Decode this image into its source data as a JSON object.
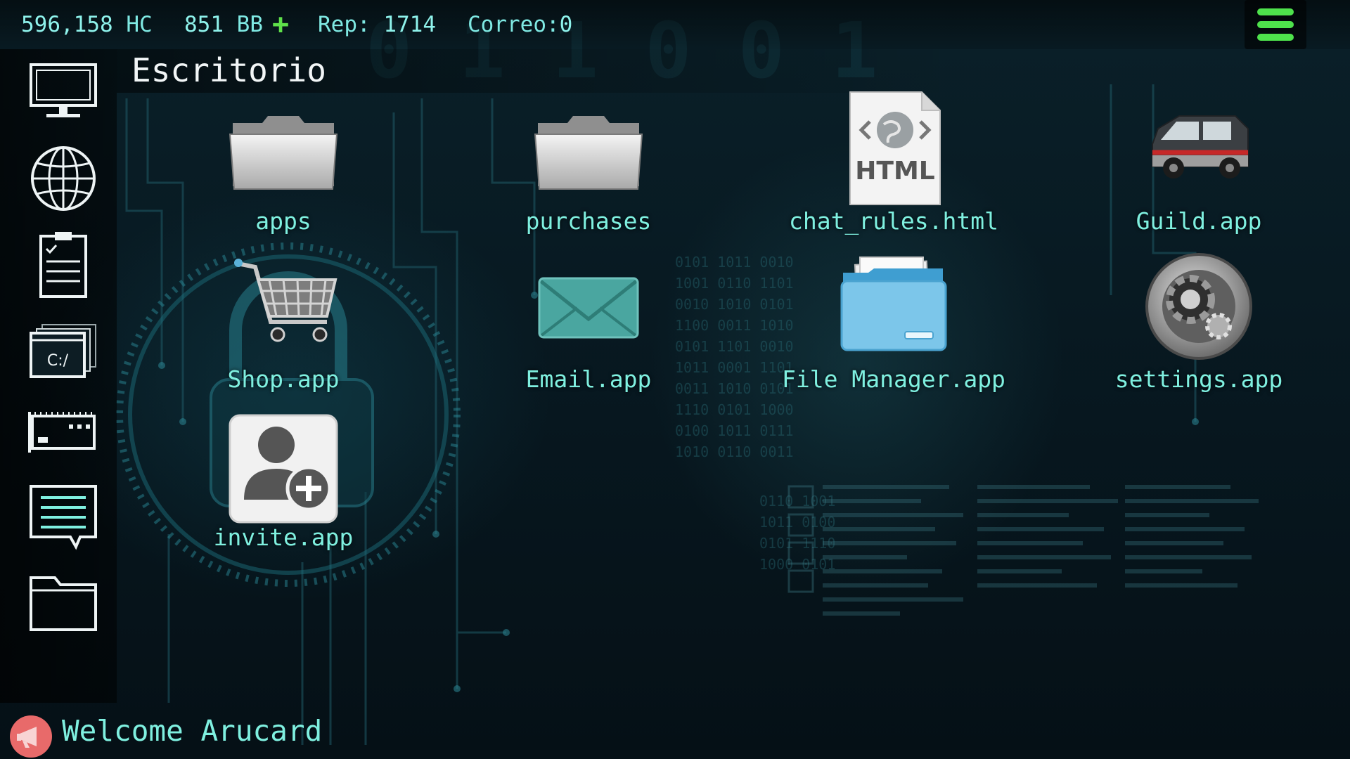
{
  "status": {
    "hc_value": "596,158",
    "hc_unit": "HC",
    "bb_value": "851",
    "bb_unit": "BB",
    "bb_add": "+",
    "rep_label": "Rep:",
    "rep_value": "1714",
    "mail_label": "Correo:",
    "mail_value": "0"
  },
  "menu": {
    "icon": "hamburger-menu-icon",
    "color": "#4ee24c"
  },
  "sidebar": {
    "items": [
      {
        "name": "desktop",
        "icon": "monitor-icon"
      },
      {
        "name": "browser",
        "icon": "globe-icon"
      },
      {
        "name": "tasks",
        "icon": "clipboard-checklist-icon"
      },
      {
        "name": "terminal",
        "icon": "terminal-window-icon",
        "text": "C:/"
      },
      {
        "name": "hardware",
        "icon": "hardware-board-icon"
      },
      {
        "name": "chat",
        "icon": "chat-bubble-icon"
      },
      {
        "name": "files",
        "icon": "folder-icon"
      }
    ]
  },
  "desktop": {
    "title": "Escritorio",
    "icons": [
      {
        "label": "apps",
        "icon": "folder-gray-icon"
      },
      {
        "label": "purchases",
        "icon": "folder-gray-icon"
      },
      {
        "label": "chat_rules.html",
        "icon": "html-file-icon",
        "badge": "HTML"
      },
      {
        "label": "Guild.app",
        "icon": "van-icon"
      },
      {
        "label": "Shop.app",
        "icon": "shopping-cart-icon"
      },
      {
        "label": "Email.app",
        "icon": "envelope-icon"
      },
      {
        "label": "File Manager.app",
        "icon": "file-manager-folder-icon"
      },
      {
        "label": "settings.app",
        "icon": "gear-settings-icon"
      },
      {
        "label": "invite.app",
        "icon": "add-user-icon"
      }
    ]
  },
  "welcome": {
    "text": "Welcome Arucard",
    "icon": "megaphone-icon"
  },
  "colors": {
    "accent_text": "#7ff0e0",
    "title_text": "#f2f6f7",
    "plus_green": "#5fe04a"
  }
}
